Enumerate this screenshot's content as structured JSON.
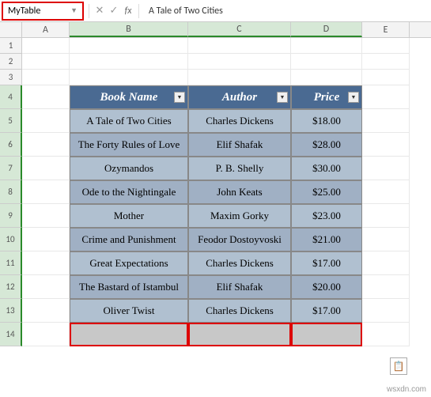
{
  "name_box": "MyTable",
  "formula_value": "A Tale of Two Cities",
  "columns": [
    "A",
    "B",
    "C",
    "D",
    "E"
  ],
  "short_rows": [
    "1",
    "2",
    "3"
  ],
  "table_start_row": "4",
  "headers": [
    "Book Name",
    "Author",
    "Price"
  ],
  "rows": [
    {
      "n": "5",
      "book": "A Tale of Two Cities",
      "author": "Charles Dickens",
      "price": "$18.00"
    },
    {
      "n": "6",
      "book": "The Forty Rules of Love",
      "author": "Elif Shafak",
      "price": "$28.00"
    },
    {
      "n": "7",
      "book": "Ozymandos",
      "author": "P. B. Shelly",
      "price": "$30.00"
    },
    {
      "n": "8",
      "book": "Ode to the Nightingale",
      "author": "John Keats",
      "price": "$25.00"
    },
    {
      "n": "9",
      "book": "Mother",
      "author": "Maxim Gorky",
      "price": "$23.00"
    },
    {
      "n": "10",
      "book": "Crime and Punishment",
      "author": "Feodor Dostoyvoski",
      "price": "$21.00"
    },
    {
      "n": "11",
      "book": "Great Expectations",
      "author": "Charles Dickens",
      "price": "$17.00"
    },
    {
      "n": "12",
      "book": "The Bastard of Istambul",
      "author": "Elif Shafak",
      "price": "$20.00"
    },
    {
      "n": "13",
      "book": "Oliver Twist",
      "author": "Charles Dickens",
      "price": "$17.00"
    }
  ],
  "empty_row": "14",
  "watermark": "wsxdn.com"
}
